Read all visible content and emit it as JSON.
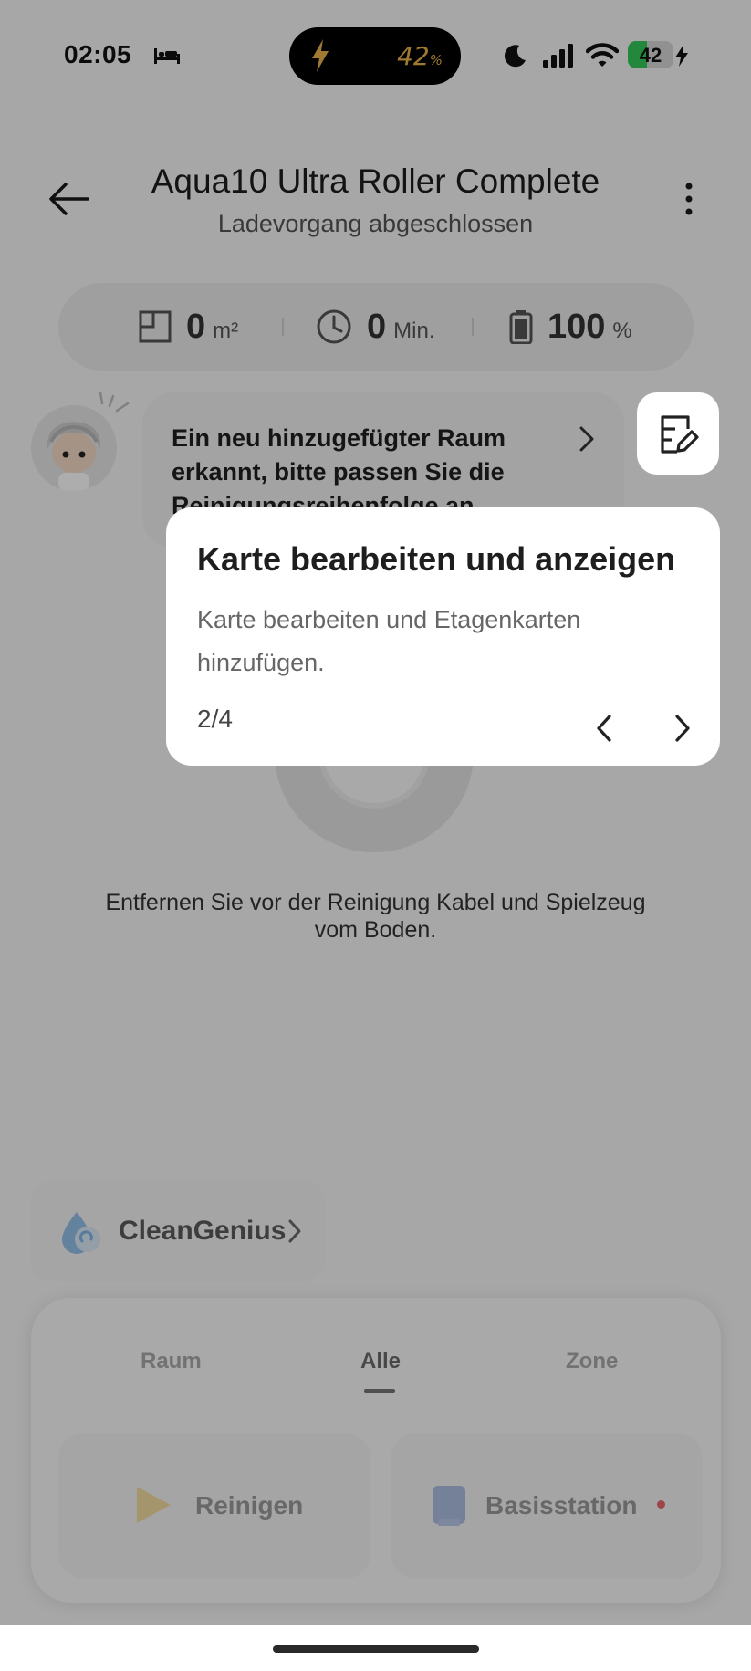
{
  "status_bar": {
    "time": "02:05",
    "island_percent": "42",
    "island_percent_unit": "%",
    "battery_level": "42",
    "battery_fraction": 0.42
  },
  "header": {
    "title": "Aqua10 Ultra Roller Complete",
    "subtitle": "Ladevorgang abgeschlossen"
  },
  "stats": {
    "area_value": "0",
    "area_unit": "m²",
    "time_value": "0",
    "time_unit": "Min.",
    "battery_value": "100",
    "battery_unit": "%"
  },
  "message": {
    "text": "Ein neu hinzugefügter Raum erkannt, bitte passen Sie die Reinigungsreihenfolge an"
  },
  "hint_text": "Entfernen Sie vor der Reinigung Kabel und Spielzeug vom Boden.",
  "clean_genius": {
    "label": "CleanGenius"
  },
  "tabs": [
    {
      "label": "Raum",
      "active": false
    },
    {
      "label": "Alle",
      "active": true
    },
    {
      "label": "Zone",
      "active": false
    }
  ],
  "actions": {
    "clean_label": "Reinigen",
    "base_label": "Basisstation"
  },
  "tooltip": {
    "title": "Karte bearbeiten und anzeigen",
    "body": "Karte bearbeiten und Etagenkarten hinzufügen.",
    "step": "2/4"
  },
  "colors": {
    "battery_green": "#34c759",
    "island_accent": "#e8b34a",
    "clean_icon": "#f2d27a",
    "base_icon": "#8fa6d8",
    "notify_dot": "#e8686e",
    "clean_genius_drop": "#7fb6e6"
  },
  "icons": {
    "edit_map": "map-edit-icon",
    "back": "arrow-left-icon",
    "more": "more-vertical-icon"
  }
}
